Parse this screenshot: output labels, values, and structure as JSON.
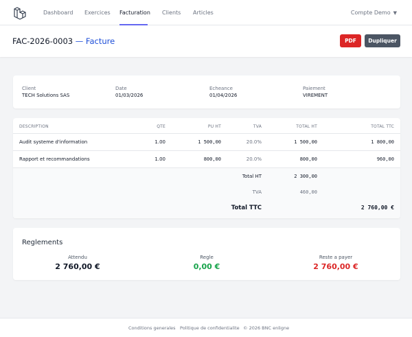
{
  "nav": {
    "links": [
      "Dashboard",
      "Exercices",
      "Facturation",
      "Clients",
      "Articles"
    ],
    "active": "Facturation",
    "account": "Compte Demo"
  },
  "header": {
    "invoice_number": "FAC-2026-0003",
    "subtitle": "— Facture",
    "pdf_label": "PDF",
    "duplicate_label": "Dupliquer"
  },
  "info": {
    "client_label": "Client",
    "client_value": "TECH Solutions SAS",
    "date_label": "Date",
    "date_value": "01/03/2026",
    "due_label": "Echeance",
    "due_value": "01/04/2026",
    "payment_label": "Paiement",
    "payment_value": "VIREMENT"
  },
  "table": {
    "headers": [
      "DESCRIPTION",
      "QTE",
      "PU HT",
      "TVA",
      "TOTAL HT",
      "TOTAL TTC"
    ],
    "rows": [
      {
        "description": "Audit systeme d'information",
        "qty": "1.00",
        "unit_price": "1 500,00",
        "vat": "20.0%",
        "total_ht": "1 500,00",
        "total_ttc": "1 800,00"
      },
      {
        "description": "Rapport et recommandations",
        "qty": "1.00",
        "unit_price": "800,00",
        "vat": "20.0%",
        "total_ht": "800,00",
        "total_ttc": "960,00"
      }
    ],
    "totals": {
      "ht_label": "Total HT",
      "ht_value": "2 300,00",
      "tva_label": "TVA",
      "tva_value": "460,00",
      "ttc_label": "Total TTC",
      "ttc_value": "2 760,00 €"
    }
  },
  "reglements": {
    "title": "Reglements",
    "expected_label": "Attendu",
    "expected_value": "2 760,00 €",
    "paid_label": "Regle",
    "paid_value": "0,00 €",
    "remaining_label": "Reste a payer",
    "remaining_value": "2 760,00 €"
  },
  "footer": {
    "terms": "Conditions generales",
    "privacy": "Politique de confidentialite",
    "copyright": "© 2026 BNC enligne"
  },
  "colors": {
    "pdf_button": "#dc2626",
    "duplicate_button": "#4b5563",
    "paid_green": "#16a34a",
    "remaining_red": "#dc2626",
    "accent_blue": "#1d4ed8"
  }
}
